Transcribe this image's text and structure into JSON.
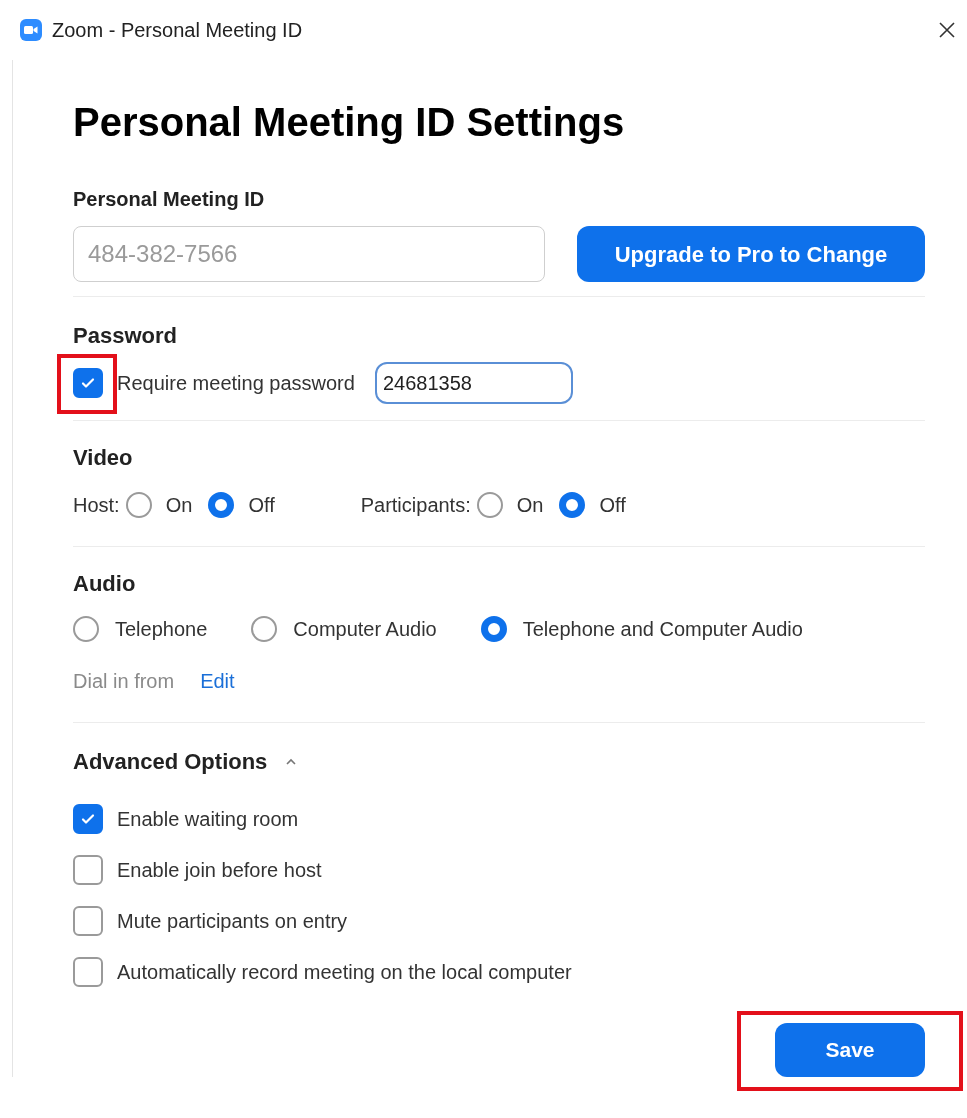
{
  "window": {
    "title": "Zoom - Personal Meeting ID"
  },
  "heading": "Personal Meeting ID Settings",
  "meeting_id": {
    "label": "Personal Meeting ID",
    "value": "484-382-7566",
    "disabled": true,
    "button": "Upgrade to Pro to Change"
  },
  "password": {
    "label": "Password",
    "require": {
      "label": "Require meeting password",
      "checked": true,
      "highlighted": true
    },
    "value": "24681358"
  },
  "video": {
    "label": "Video",
    "groups": [
      {
        "label": "Host:",
        "options": [
          {
            "label": "On",
            "selected": false
          },
          {
            "label": "Off",
            "selected": true
          }
        ]
      },
      {
        "label": "Participants:",
        "options": [
          {
            "label": "On",
            "selected": false
          },
          {
            "label": "Off",
            "selected": true
          }
        ]
      }
    ]
  },
  "audio": {
    "label": "Audio",
    "options": [
      {
        "label": "Telephone",
        "selected": false
      },
      {
        "label": "Computer Audio",
        "selected": false
      },
      {
        "label": "Telephone and Computer Audio",
        "selected": true
      }
    ],
    "dial_in": {
      "label": "Dial in from",
      "link": "Edit"
    }
  },
  "advanced": {
    "label": "Advanced Options",
    "expanded": true,
    "options": [
      {
        "label": "Enable waiting room",
        "checked": true
      },
      {
        "label": "Enable join before host",
        "checked": false
      },
      {
        "label": "Mute participants on entry",
        "checked": false
      },
      {
        "label": "Automatically record meeting on the local computer",
        "checked": false
      }
    ]
  },
  "save": {
    "label": "Save",
    "highlighted": true
  }
}
